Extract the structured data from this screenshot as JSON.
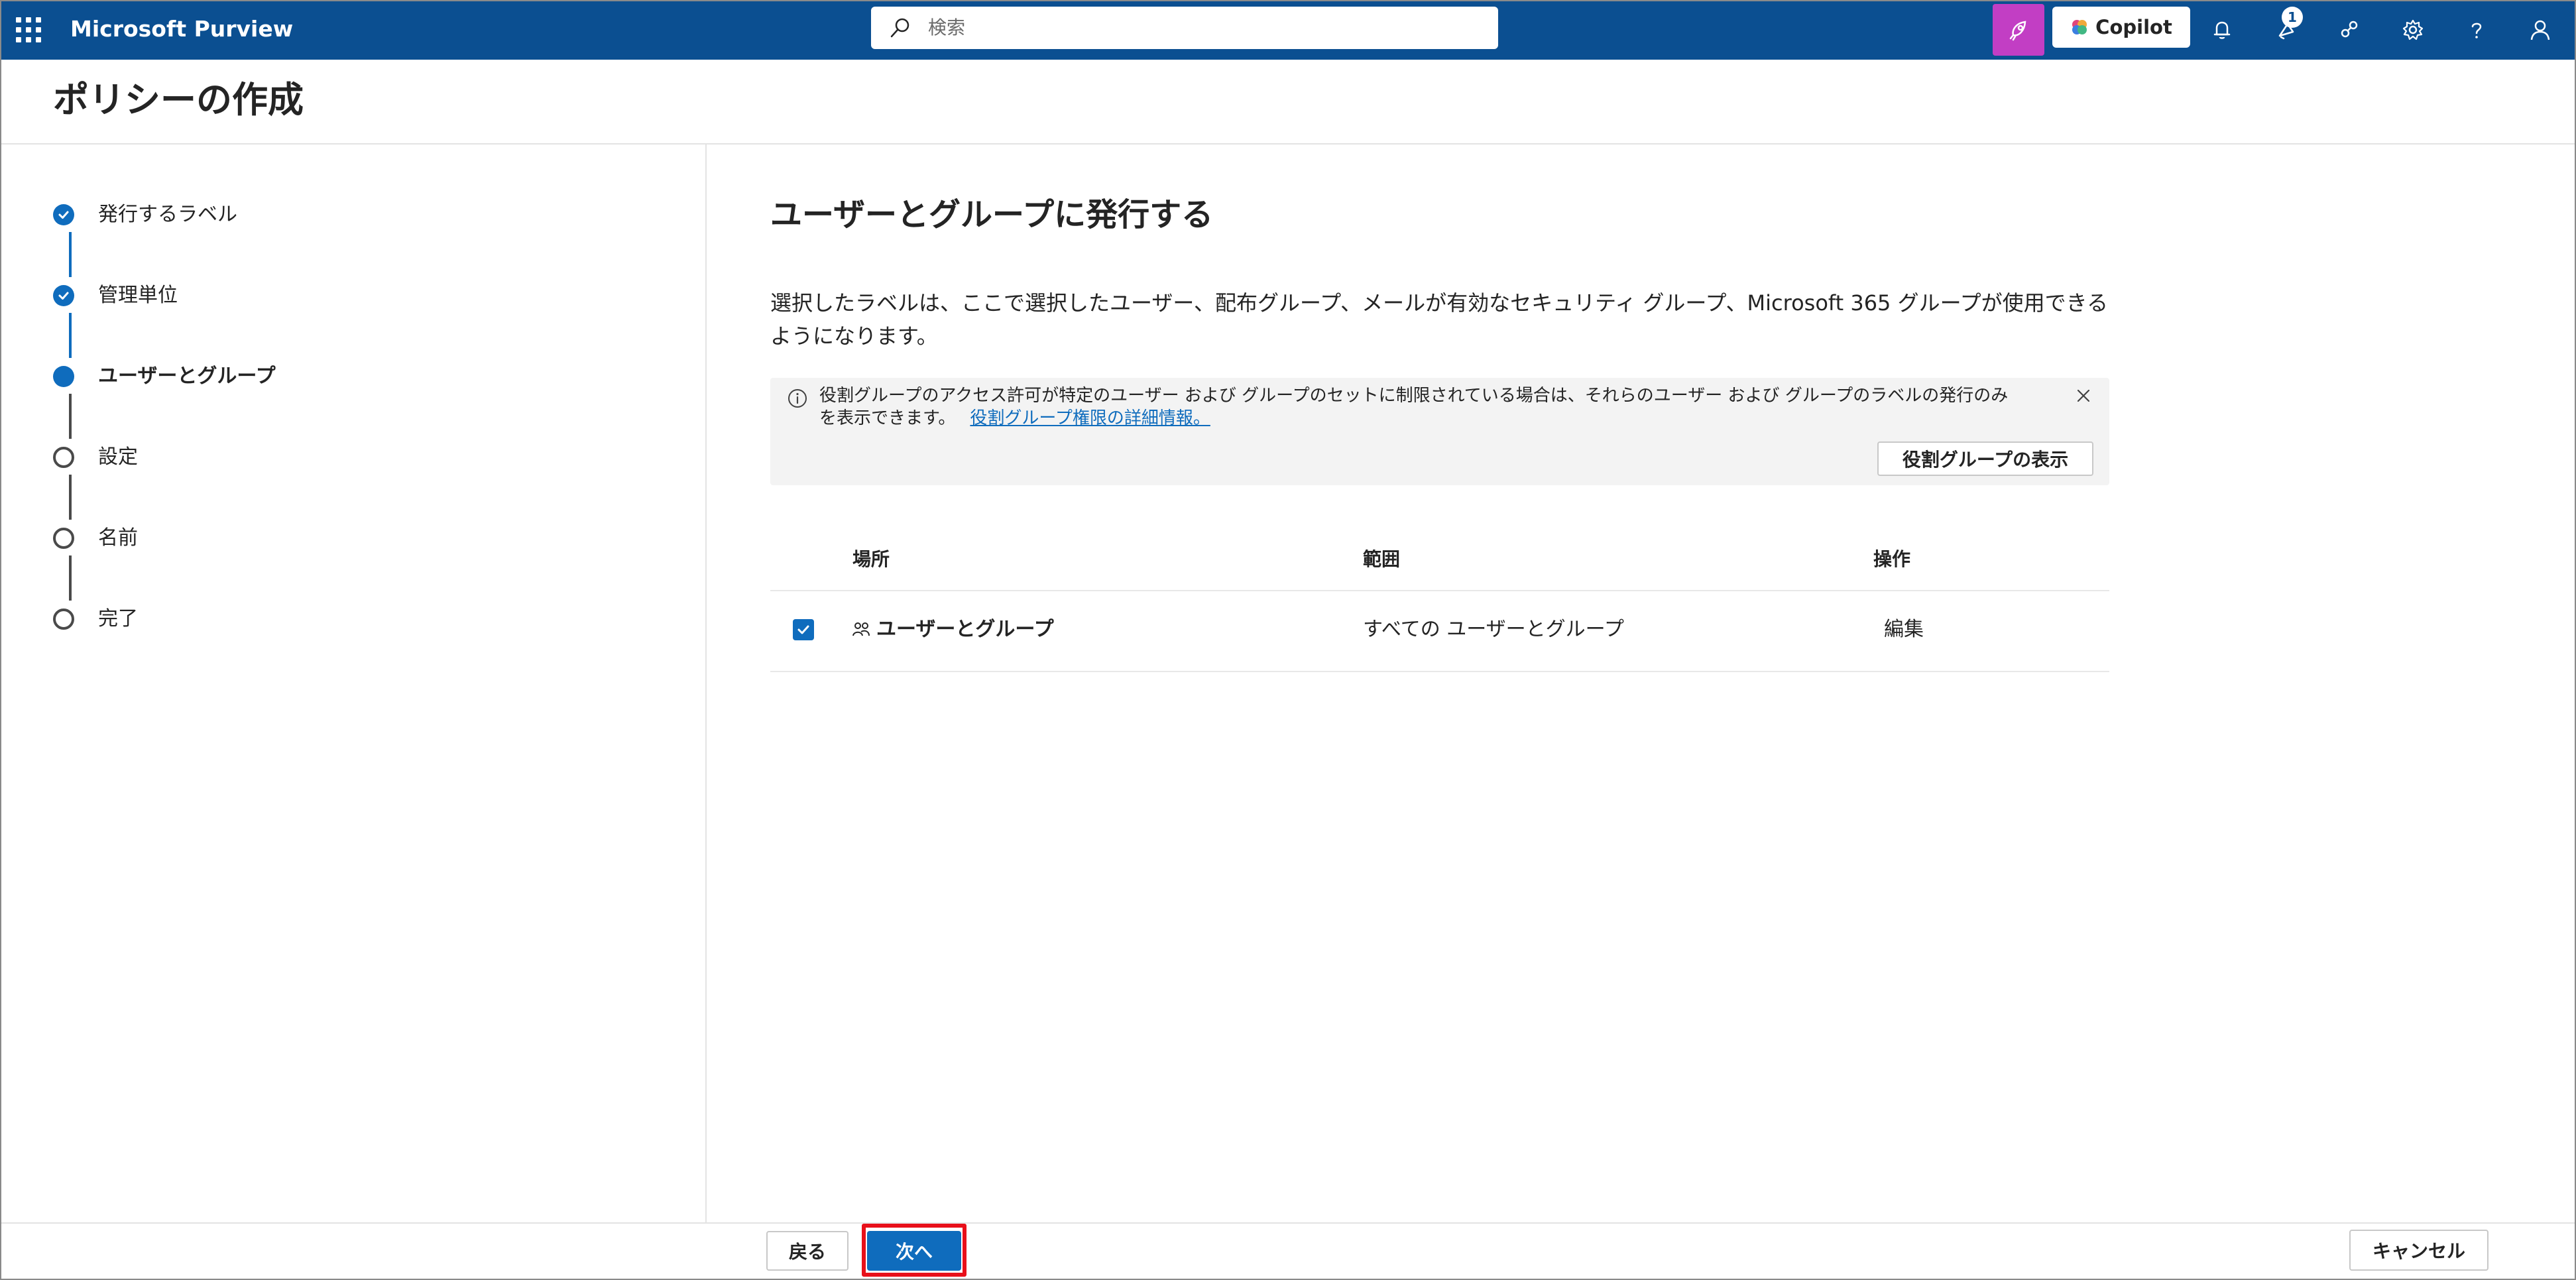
{
  "app": {
    "brand": "Microsoft Purview"
  },
  "search": {
    "placeholder": "検索"
  },
  "topbar": {
    "copilot_label": "Copilot",
    "notification_badge": "1"
  },
  "page": {
    "title": "ポリシーの作成"
  },
  "steps": [
    {
      "label": "発行するラベル",
      "state": "done"
    },
    {
      "label": "管理単位",
      "state": "done"
    },
    {
      "label": "ユーザーとグループ",
      "state": "current"
    },
    {
      "label": "設定",
      "state": "todo"
    },
    {
      "label": "名前",
      "state": "todo"
    },
    {
      "label": "完了",
      "state": "todo"
    }
  ],
  "main": {
    "heading": "ユーザーとグループに発行する",
    "description": "選択したラベルは、ここで選択したユーザー、配布グループ、メールが有効なセキュリティ グループ、Microsoft 365 グループが使用できるようになります。",
    "info": {
      "text": "役割グループのアクセス許可が特定のユーザー および グループのセットに制限されている場合は、それらのユーザー および グループのラベルの発行のみを表示できます。",
      "link": "役割グループ権限の詳細情報。",
      "button": "役割グループの表示"
    },
    "table": {
      "headers": [
        "場所",
        "範囲",
        "操作"
      ],
      "rows": [
        {
          "checked": true,
          "location": "ユーザーとグループ",
          "scope": "すべての ユーザーとグループ",
          "action": "編集"
        }
      ]
    }
  },
  "footer": {
    "back": "戻る",
    "next": "次へ",
    "cancel": "キャンセル"
  },
  "colors": {
    "topbar": "#0b4f91",
    "accent": "#0f6cbd",
    "copilot_tile": "#c23ec4",
    "highlight": "#e8101a"
  }
}
